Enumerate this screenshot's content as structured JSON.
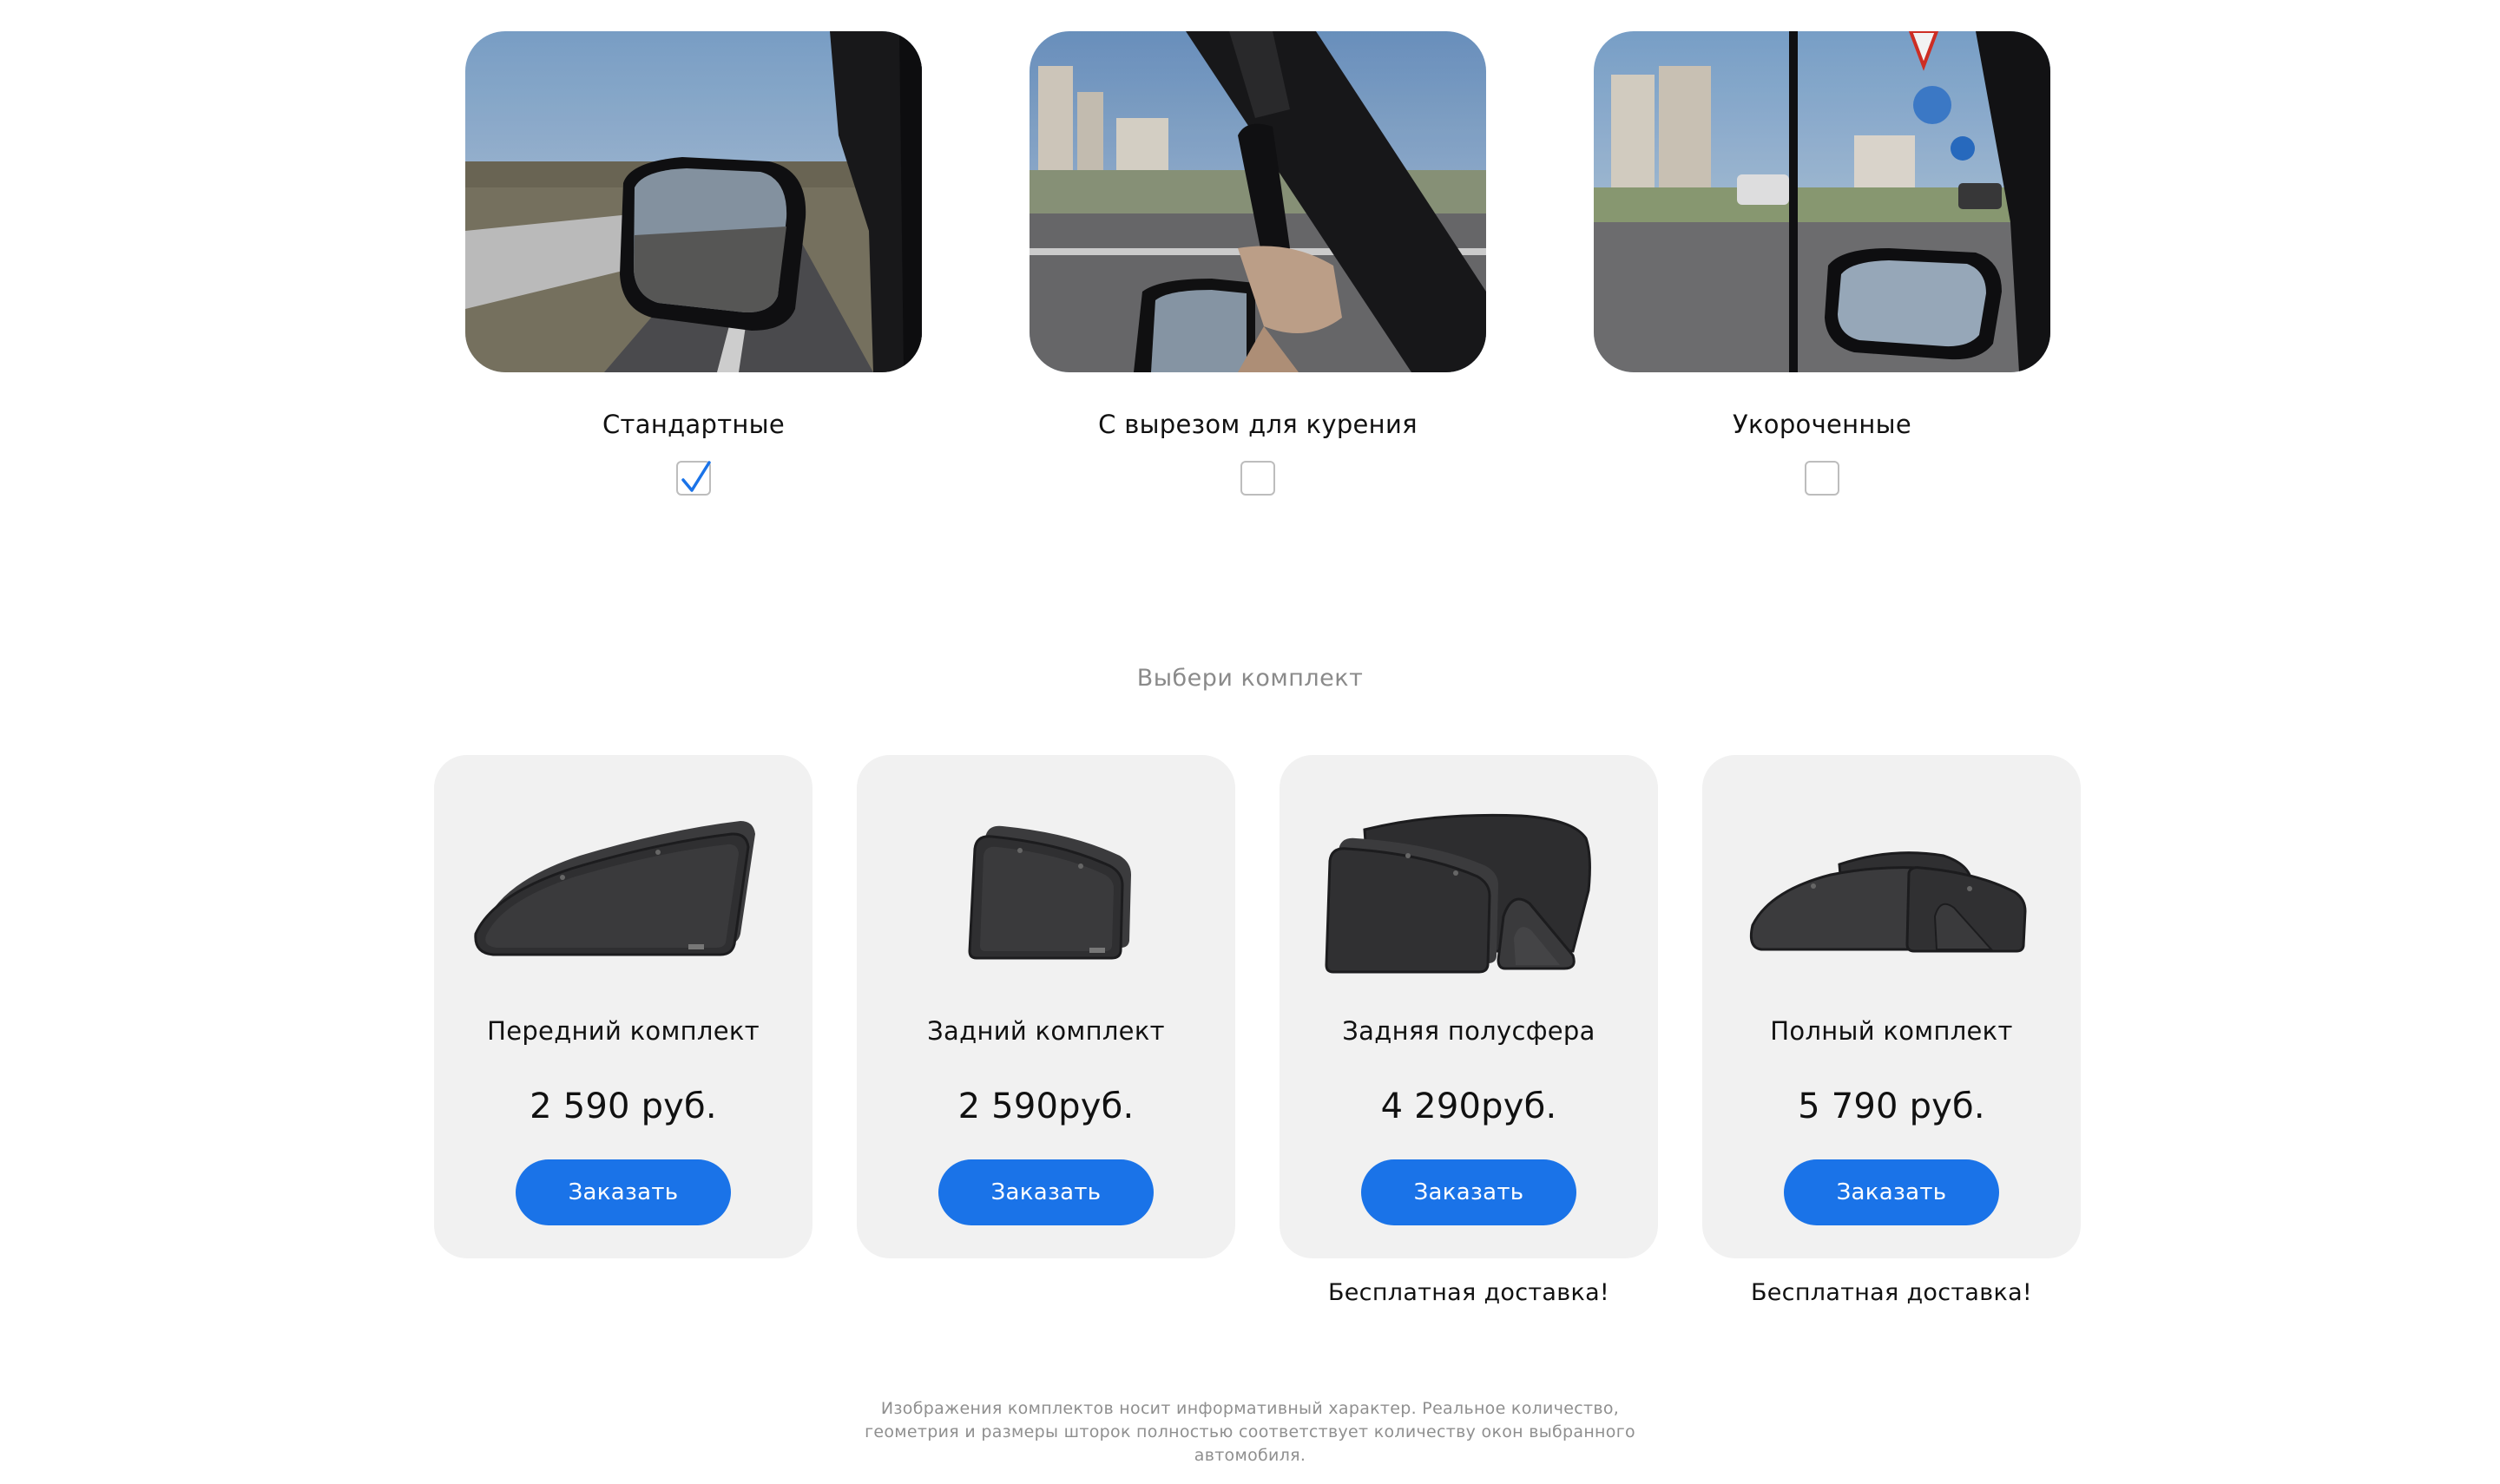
{
  "shade_types": {
    "options": [
      {
        "label": "Стандартные",
        "checked": true
      },
      {
        "label": "С вырезом для курения",
        "checked": false
      },
      {
        "label": "Укороченные",
        "checked": false
      }
    ]
  },
  "kits_section": {
    "title": "Выбери комплект",
    "order_label": "Заказать",
    "kits": [
      {
        "name": "Передний комплект",
        "price": "2 590 руб.",
        "note": ""
      },
      {
        "name": "Задний комплект",
        "price": "2 590руб.",
        "note": ""
      },
      {
        "name": "Задняя полусфера",
        "price": "4 290руб.",
        "note": "Бесплатная доставка!"
      },
      {
        "name": "Полный комплект",
        "price": "5 790 руб.",
        "note": "Бесплатная доставка!"
      }
    ]
  },
  "disclaimer": {
    "line1": "Изображения комплектов носит информативный характер. Реальное количество,",
    "line2": "геометрия и размеры шторок полностью соответствует количеству окон выбранного",
    "line3": "автомобиля."
  },
  "colors": {
    "accent": "#1a73e8",
    "card_background": "#f1f1f1",
    "muted_text": "#8a8a8a"
  }
}
